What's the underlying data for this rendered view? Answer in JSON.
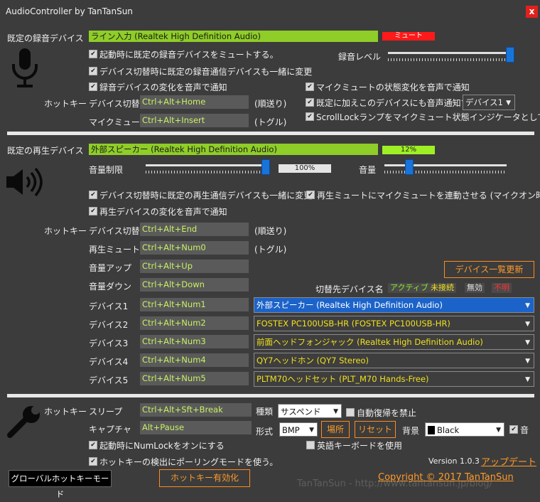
{
  "window": {
    "title": "AudioController by TanTanSun",
    "close_label": "x"
  },
  "rec": {
    "section_label": "既定の録音デバイス",
    "device": "ライン入力 (Realtek High Definition Audio)",
    "mute_badge": "ミュート",
    "check_mute_startup": "起動時に既定の録音デバイスをミュートする。",
    "check_switch_comm": "デバイス切替時に既定の録音通信デバイスも一緒に変更",
    "check_notify_change": "録音デバイスの変化を音声で通知",
    "level_label": "録音レベル",
    "level_value": 0.97,
    "check_mic_notify": "マイクミュートの状態変化を音声で通知",
    "check_also_notify": "既定に加えこのデバイスにも音声通知する",
    "also_device": "デバイス1",
    "check_scrolllock": "ScrollLockランプをマイクミュート状態インジケータとして使う",
    "hotkey_label": "ホットキー",
    "switch_label": "デバイス切替",
    "switch_key": "Ctrl+Alt+Home",
    "switch_note": "(順送り)",
    "mute_label": "マイクミュート",
    "mute_key": "Ctrl+Alt+Insert",
    "mute_note": "(トグル)"
  },
  "play": {
    "section_label": "既定の再生デバイス",
    "device": "外部スピーカー (Realtek High Definition Audio)",
    "volume_badge": "12%",
    "limit_label": "音量制限",
    "limit_value": "100%",
    "limit_fraction": 1.0,
    "volume_label": "音量",
    "volume_fraction": 0.12,
    "check_switch_comm": "デバイス切替時に既定の再生通信デバイスも一緒に変更",
    "check_link_mic": "再生ミュートにマイクミュートを連動させる (マイクオン時のみ)",
    "check_notify_change": "再生デバイスの変化を音声で通知",
    "hotkey_label": "ホットキー",
    "rows": [
      {
        "label": "デバイス切替",
        "key": "Ctrl+Alt+End",
        "note": "(順送り)"
      },
      {
        "label": "再生ミュート",
        "key": "Ctrl+Alt+Num0",
        "note": "(トグル)"
      },
      {
        "label": "音量アップ",
        "key": "Ctrl+Alt+Up",
        "note": ""
      },
      {
        "label": "音量ダウン",
        "key": "Ctrl+Alt+Down",
        "note": ""
      }
    ],
    "refresh_button": "デバイス一覧更新",
    "target_label": "切替先デバイス名",
    "legend": {
      "active": "アクティブ",
      "unconnected": "未接続",
      "disabled": "無効",
      "unknown": "不明"
    },
    "devices": [
      {
        "label": "デバイス1",
        "key": "Ctrl+Alt+Num1",
        "name": "外部スピーカー (Realtek High Definition Audio)"
      },
      {
        "label": "デバイス2",
        "key": "Ctrl+Alt+Num2",
        "name": "FOSTEX PC100USB-HR (FOSTEX PC100USB-HR)"
      },
      {
        "label": "デバイス3",
        "key": "Ctrl+Alt+Num3",
        "name": "前面ヘッドフォンジャック (Realtek High Definition Audio)"
      },
      {
        "label": "デバイス4",
        "key": "Ctrl+Alt+Num4",
        "name": "QY7ヘッドホン (QY7 Stereo)"
      },
      {
        "label": "デバイス5",
        "key": "Ctrl+Alt+Num5",
        "name": "PLTM70ヘッドセット (PLT_M70 Hands-Free)"
      }
    ]
  },
  "misc": {
    "hotkey_label": "ホットキー",
    "sleep_label": "スリープ",
    "sleep_key": "Ctrl+Alt+Sft+Break",
    "capture_label": "キャプチャ",
    "capture_key": "Alt+Pause",
    "type_label": "種類",
    "type_value": "サスペンド",
    "check_no_resume": "自動復帰を禁止",
    "format_label": "形式",
    "format_value": "BMP",
    "location_button": "場所",
    "reset_button": "リセット",
    "bg_label": "背景",
    "bg_value": "Black",
    "check_sound": "音",
    "check_numlock": "起動時にNumLockをオンにする",
    "check_polling": "ホットキーの検出にポーリングモードを使う。",
    "check_english_kb": "英語キーボードを使用",
    "version": "Version 1.0.3",
    "update_link": "アップデート",
    "global_mode_button": "グローバルホットキーモード",
    "enable_hotkey_button": "ホットキー有効化",
    "copyright": "Copyright © 2017 TanTanSun",
    "watermark": "TanTanSun - http://www.tantansun.jp/blog/"
  }
}
